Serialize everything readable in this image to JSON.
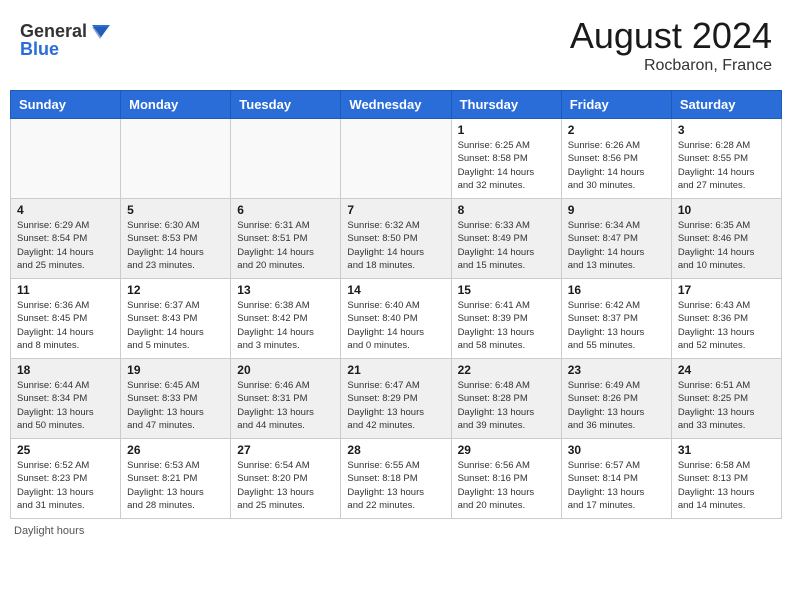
{
  "header": {
    "logo_general": "General",
    "logo_blue": "Blue",
    "month_year": "August 2024",
    "location": "Rocbaron, France"
  },
  "footer": {
    "note": "Daylight hours"
  },
  "weekdays": [
    "Sunday",
    "Monday",
    "Tuesday",
    "Wednesday",
    "Thursday",
    "Friday",
    "Saturday"
  ],
  "weeks": [
    [
      {
        "day": "",
        "info": ""
      },
      {
        "day": "",
        "info": ""
      },
      {
        "day": "",
        "info": ""
      },
      {
        "day": "",
        "info": ""
      },
      {
        "day": "1",
        "info": "Sunrise: 6:25 AM\nSunset: 8:58 PM\nDaylight: 14 hours\nand 32 minutes."
      },
      {
        "day": "2",
        "info": "Sunrise: 6:26 AM\nSunset: 8:56 PM\nDaylight: 14 hours\nand 30 minutes."
      },
      {
        "day": "3",
        "info": "Sunrise: 6:28 AM\nSunset: 8:55 PM\nDaylight: 14 hours\nand 27 minutes."
      }
    ],
    [
      {
        "day": "4",
        "info": "Sunrise: 6:29 AM\nSunset: 8:54 PM\nDaylight: 14 hours\nand 25 minutes."
      },
      {
        "day": "5",
        "info": "Sunrise: 6:30 AM\nSunset: 8:53 PM\nDaylight: 14 hours\nand 23 minutes."
      },
      {
        "day": "6",
        "info": "Sunrise: 6:31 AM\nSunset: 8:51 PM\nDaylight: 14 hours\nand 20 minutes."
      },
      {
        "day": "7",
        "info": "Sunrise: 6:32 AM\nSunset: 8:50 PM\nDaylight: 14 hours\nand 18 minutes."
      },
      {
        "day": "8",
        "info": "Sunrise: 6:33 AM\nSunset: 8:49 PM\nDaylight: 14 hours\nand 15 minutes."
      },
      {
        "day": "9",
        "info": "Sunrise: 6:34 AM\nSunset: 8:47 PM\nDaylight: 14 hours\nand 13 minutes."
      },
      {
        "day": "10",
        "info": "Sunrise: 6:35 AM\nSunset: 8:46 PM\nDaylight: 14 hours\nand 10 minutes."
      }
    ],
    [
      {
        "day": "11",
        "info": "Sunrise: 6:36 AM\nSunset: 8:45 PM\nDaylight: 14 hours\nand 8 minutes."
      },
      {
        "day": "12",
        "info": "Sunrise: 6:37 AM\nSunset: 8:43 PM\nDaylight: 14 hours\nand 5 minutes."
      },
      {
        "day": "13",
        "info": "Sunrise: 6:38 AM\nSunset: 8:42 PM\nDaylight: 14 hours\nand 3 minutes."
      },
      {
        "day": "14",
        "info": "Sunrise: 6:40 AM\nSunset: 8:40 PM\nDaylight: 14 hours\nand 0 minutes."
      },
      {
        "day": "15",
        "info": "Sunrise: 6:41 AM\nSunset: 8:39 PM\nDaylight: 13 hours\nand 58 minutes."
      },
      {
        "day": "16",
        "info": "Sunrise: 6:42 AM\nSunset: 8:37 PM\nDaylight: 13 hours\nand 55 minutes."
      },
      {
        "day": "17",
        "info": "Sunrise: 6:43 AM\nSunset: 8:36 PM\nDaylight: 13 hours\nand 52 minutes."
      }
    ],
    [
      {
        "day": "18",
        "info": "Sunrise: 6:44 AM\nSunset: 8:34 PM\nDaylight: 13 hours\nand 50 minutes."
      },
      {
        "day": "19",
        "info": "Sunrise: 6:45 AM\nSunset: 8:33 PM\nDaylight: 13 hours\nand 47 minutes."
      },
      {
        "day": "20",
        "info": "Sunrise: 6:46 AM\nSunset: 8:31 PM\nDaylight: 13 hours\nand 44 minutes."
      },
      {
        "day": "21",
        "info": "Sunrise: 6:47 AM\nSunset: 8:29 PM\nDaylight: 13 hours\nand 42 minutes."
      },
      {
        "day": "22",
        "info": "Sunrise: 6:48 AM\nSunset: 8:28 PM\nDaylight: 13 hours\nand 39 minutes."
      },
      {
        "day": "23",
        "info": "Sunrise: 6:49 AM\nSunset: 8:26 PM\nDaylight: 13 hours\nand 36 minutes."
      },
      {
        "day": "24",
        "info": "Sunrise: 6:51 AM\nSunset: 8:25 PM\nDaylight: 13 hours\nand 33 minutes."
      }
    ],
    [
      {
        "day": "25",
        "info": "Sunrise: 6:52 AM\nSunset: 8:23 PM\nDaylight: 13 hours\nand 31 minutes."
      },
      {
        "day": "26",
        "info": "Sunrise: 6:53 AM\nSunset: 8:21 PM\nDaylight: 13 hours\nand 28 minutes."
      },
      {
        "day": "27",
        "info": "Sunrise: 6:54 AM\nSunset: 8:20 PM\nDaylight: 13 hours\nand 25 minutes."
      },
      {
        "day": "28",
        "info": "Sunrise: 6:55 AM\nSunset: 8:18 PM\nDaylight: 13 hours\nand 22 minutes."
      },
      {
        "day": "29",
        "info": "Sunrise: 6:56 AM\nSunset: 8:16 PM\nDaylight: 13 hours\nand 20 minutes."
      },
      {
        "day": "30",
        "info": "Sunrise: 6:57 AM\nSunset: 8:14 PM\nDaylight: 13 hours\nand 17 minutes."
      },
      {
        "day": "31",
        "info": "Sunrise: 6:58 AM\nSunset: 8:13 PM\nDaylight: 13 hours\nand 14 minutes."
      }
    ]
  ]
}
